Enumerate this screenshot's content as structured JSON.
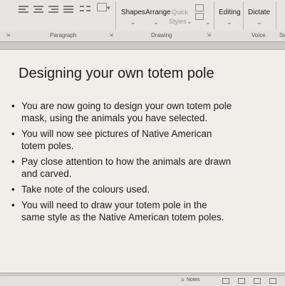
{
  "ribbon": {
    "shapes_label": "Shapes",
    "arrange_label": "Arrange",
    "quick_styles_label": "Quick",
    "styles_label": "Styles",
    "editing_label": "Editing",
    "dictate_label": "Dictate",
    "groups": {
      "paragraph": "Paragraph",
      "drawing": "Drawing",
      "voice": "Voice",
      "partial": "Se"
    }
  },
  "slide": {
    "title": "Designing your own totem pole",
    "bullets": [
      {
        "line1": "You are now going to design your own totem pole",
        "line2": "mask, using the animals you have selected."
      },
      {
        "line1": "You will now see pictures of Native American",
        "line2": "totem poles."
      },
      {
        "line1": "Pay close attention to how the animals are drawn",
        "line2": "and carved."
      },
      {
        "line1": "Take note of the colours used.",
        "line2": ""
      },
      {
        "line1": "You will need to draw your totem pole in the",
        "line2": "same style as the Native American totem poles."
      }
    ]
  },
  "statusbar": {
    "notes_label": "Notes"
  }
}
